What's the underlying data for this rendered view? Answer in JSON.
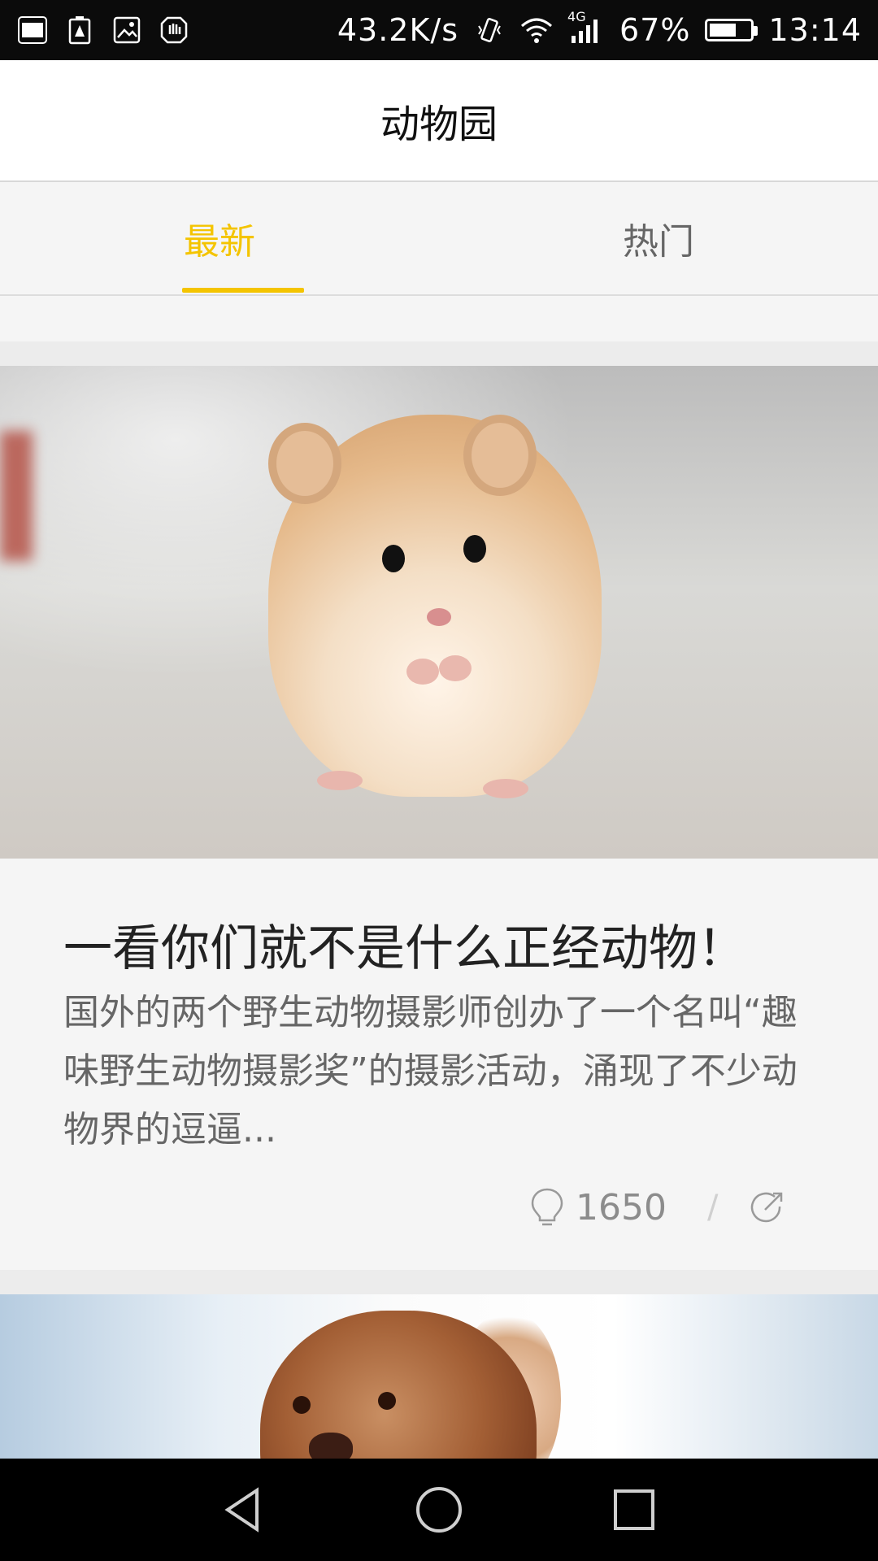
{
  "status_bar": {
    "network_speed": "43.2K/s",
    "network_type": "4G",
    "battery_percent": "67%",
    "battery_level": 0.67,
    "time": "13:14",
    "left_icons": [
      "toutiao-app-icon",
      "battery-warning-icon",
      "image-icon",
      "hand-icon"
    ]
  },
  "app_bar": {
    "title": "动物园"
  },
  "tabs": [
    {
      "label": "最新",
      "active": true
    },
    {
      "label": "热门",
      "active": false
    }
  ],
  "colors": {
    "accent": "#f4c400",
    "background": "#f5f5f5"
  },
  "feed": [
    {
      "image_subject": "hamster",
      "title": "一看你们就不是什么正经动物！",
      "description": "国外的两个野生动物摄影师创办了一个名叫“趣味野生动物摄影奖”的摄影活动，涌现了不少动物界的逗逼...",
      "count": "1650",
      "meta_icons": [
        "lightbulb-icon",
        "share-icon"
      ]
    },
    {
      "image_subject": "dog"
    }
  ],
  "nav_bar": {
    "buttons": [
      "back-icon",
      "home-icon",
      "recents-icon"
    ]
  }
}
